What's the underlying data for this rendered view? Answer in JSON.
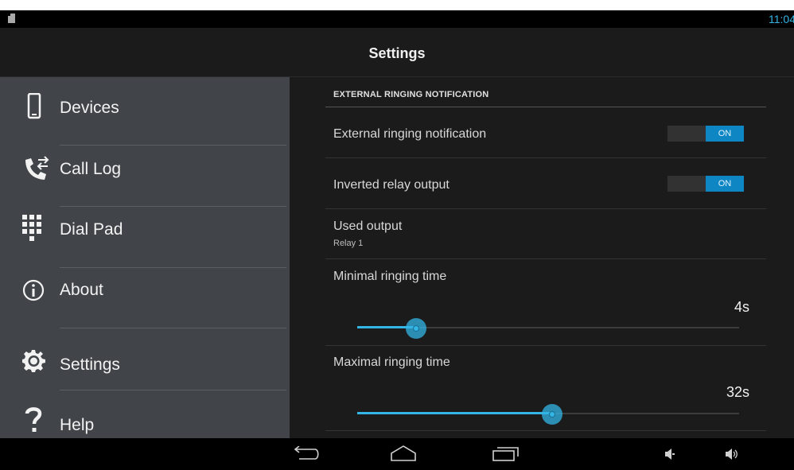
{
  "status_bar": {
    "time": "11:04",
    "accent": "#33b5e5"
  },
  "action_bar": {
    "title": "Settings"
  },
  "sidebar": {
    "items": [
      {
        "label": "Devices",
        "icon": "phone-device-icon"
      },
      {
        "label": "Call Log",
        "icon": "call-log-icon"
      },
      {
        "label": "Dial Pad",
        "icon": "dial-pad-icon"
      },
      {
        "label": "About",
        "icon": "info-icon"
      },
      {
        "label": "Settings",
        "icon": "gear-icon"
      },
      {
        "label": "Help",
        "icon": "question-icon"
      }
    ]
  },
  "main": {
    "section_header": "EXTERNAL RINGING NOTIFICATION",
    "external_ringing": {
      "label": "External ringing notification",
      "state": "ON"
    },
    "inverted_relay": {
      "label": "Inverted relay output",
      "state": "ON"
    },
    "used_output": {
      "label": "Used output",
      "value": "Relay 1"
    },
    "minimal_ringing": {
      "label": "Minimal ringing time",
      "value_text": "4s",
      "fill_fraction": 0.155
    },
    "maximal_ringing": {
      "label": "Maximal ringing time",
      "value_text": "32s",
      "fill_fraction": 0.51
    }
  },
  "nav_bar": {
    "buttons": [
      "back-icon",
      "home-icon",
      "recent-apps-icon",
      "volume-down-icon",
      "volume-up-icon"
    ]
  },
  "colors": {
    "accent": "#33b5e5",
    "toggle_on": "#0f86c4",
    "sidebar_bg": "#414549",
    "content_bg": "#1b1b1b"
  }
}
